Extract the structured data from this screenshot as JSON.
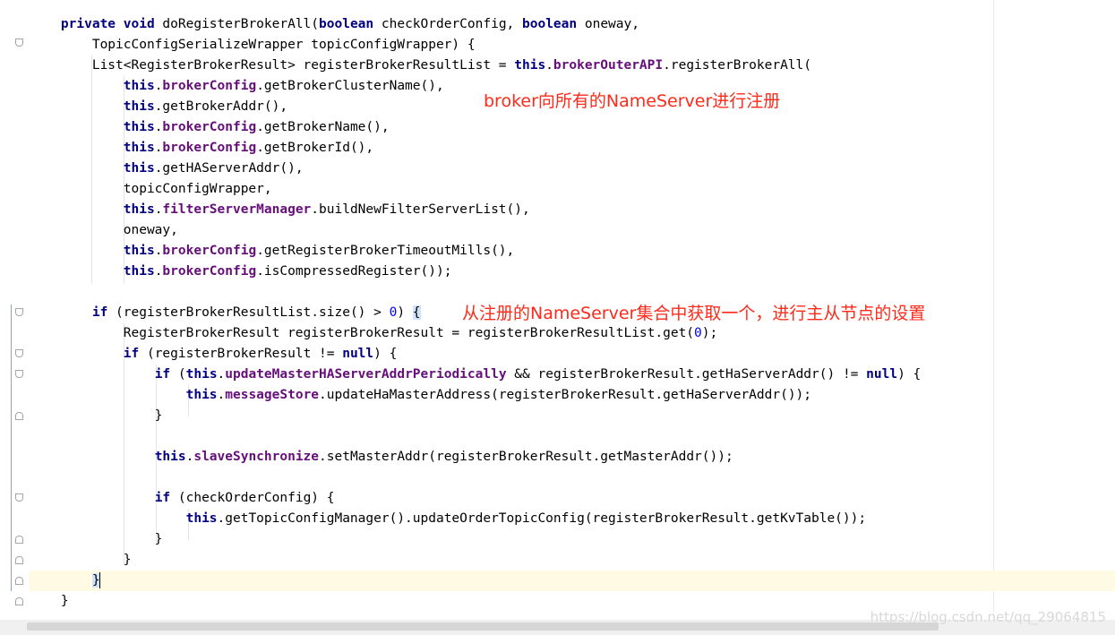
{
  "editor": {
    "lines": [
      [
        {
          "t": "    "
        },
        {
          "t": "private void ",
          "c": "kw"
        },
        {
          "t": "doRegisterBrokerAll("
        },
        {
          "t": "boolean ",
          "c": "kw"
        },
        {
          "t": "checkOrderConfig, "
        },
        {
          "t": "boolean ",
          "c": "kw"
        },
        {
          "t": "oneway,"
        }
      ],
      [
        {
          "t": "        TopicConfigSerializeWrapper topicConfigWrapper) {"
        }
      ],
      [
        {
          "t": "        List<RegisterBrokerResult> registerBrokerResultList = "
        },
        {
          "t": "this",
          "c": "kw"
        },
        {
          "t": "."
        },
        {
          "t": "brokerOuterAPI",
          "c": "field"
        },
        {
          "t": ".registerBrokerAll("
        }
      ],
      [
        {
          "t": "            "
        },
        {
          "t": "this",
          "c": "kw"
        },
        {
          "t": "."
        },
        {
          "t": "brokerConfig",
          "c": "field"
        },
        {
          "t": ".getBrokerClusterName(),"
        }
      ],
      [
        {
          "t": "            "
        },
        {
          "t": "this",
          "c": "kw"
        },
        {
          "t": ".getBrokerAddr(),"
        }
      ],
      [
        {
          "t": "            "
        },
        {
          "t": "this",
          "c": "kw"
        },
        {
          "t": "."
        },
        {
          "t": "brokerConfig",
          "c": "field"
        },
        {
          "t": ".getBrokerName(),"
        }
      ],
      [
        {
          "t": "            "
        },
        {
          "t": "this",
          "c": "kw"
        },
        {
          "t": "."
        },
        {
          "t": "brokerConfig",
          "c": "field"
        },
        {
          "t": ".getBrokerId(),"
        }
      ],
      [
        {
          "t": "            "
        },
        {
          "t": "this",
          "c": "kw"
        },
        {
          "t": ".getHAServerAddr(),"
        }
      ],
      [
        {
          "t": "            topicConfigWrapper,"
        }
      ],
      [
        {
          "t": "            "
        },
        {
          "t": "this",
          "c": "kw"
        },
        {
          "t": "."
        },
        {
          "t": "filterServerManager",
          "c": "field"
        },
        {
          "t": ".buildNewFilterServerList(),"
        }
      ],
      [
        {
          "t": "            oneway,"
        }
      ],
      [
        {
          "t": "            "
        },
        {
          "t": "this",
          "c": "kw"
        },
        {
          "t": "."
        },
        {
          "t": "brokerConfig",
          "c": "field"
        },
        {
          "t": ".getRegisterBrokerTimeoutMills(),"
        }
      ],
      [
        {
          "t": "            "
        },
        {
          "t": "this",
          "c": "kw"
        },
        {
          "t": "."
        },
        {
          "t": "brokerConfig",
          "c": "field"
        },
        {
          "t": ".isCompressedRegister());"
        }
      ],
      [
        {
          "t": ""
        }
      ],
      [
        {
          "t": "        "
        },
        {
          "t": "if ",
          "c": "kw"
        },
        {
          "t": "(registerBrokerResultList.size() > "
        },
        {
          "t": "0",
          "c": "num"
        },
        {
          "t": ") "
        },
        {
          "t": "{",
          "c": "brace-hl"
        }
      ],
      [
        {
          "t": "            RegisterBrokerResult registerBrokerResult = registerBrokerResultList.get("
        },
        {
          "t": "0",
          "c": "num"
        },
        {
          "t": ");"
        }
      ],
      [
        {
          "t": "            "
        },
        {
          "t": "if ",
          "c": "kw"
        },
        {
          "t": "(registerBrokerResult != "
        },
        {
          "t": "null",
          "c": "kw"
        },
        {
          "t": ") {"
        }
      ],
      [
        {
          "t": "                "
        },
        {
          "t": "if ",
          "c": "kw"
        },
        {
          "t": "("
        },
        {
          "t": "this",
          "c": "kw"
        },
        {
          "t": "."
        },
        {
          "t": "updateMasterHAServerAddrPeriodically",
          "c": "field"
        },
        {
          "t": " && registerBrokerResult.getHaServerAddr() != "
        },
        {
          "t": "null",
          "c": "kw"
        },
        {
          "t": ") {"
        }
      ],
      [
        {
          "t": "                    "
        },
        {
          "t": "this",
          "c": "kw"
        },
        {
          "t": "."
        },
        {
          "t": "messageStore",
          "c": "field"
        },
        {
          "t": ".updateHaMasterAddress(registerBrokerResult.getHaServerAddr());"
        }
      ],
      [
        {
          "t": "                }"
        }
      ],
      [
        {
          "t": ""
        }
      ],
      [
        {
          "t": "                "
        },
        {
          "t": "this",
          "c": "kw"
        },
        {
          "t": "."
        },
        {
          "t": "slaveSynchronize",
          "c": "field"
        },
        {
          "t": ".setMasterAddr(registerBrokerResult.getMasterAddr());"
        }
      ],
      [
        {
          "t": ""
        }
      ],
      [
        {
          "t": "                "
        },
        {
          "t": "if ",
          "c": "kw"
        },
        {
          "t": "(checkOrderConfig) {"
        }
      ],
      [
        {
          "t": "                    "
        },
        {
          "t": "this",
          "c": "kw"
        },
        {
          "t": ".getTopicConfigManager().updateOrderTopicConfig(registerBrokerResult.getKvTable());"
        }
      ],
      [
        {
          "t": "                }"
        }
      ],
      [
        {
          "t": "            }"
        }
      ],
      [
        {
          "t": "        "
        },
        {
          "t": "}",
          "c": "brace-hl"
        }
      ],
      [
        {
          "t": "    }"
        }
      ]
    ]
  },
  "annotations": {
    "note1": "broker向所有的NameServer进行注册",
    "note2": "从注册的NameServer集合中获取一个，进行主从节点的设置"
  },
  "watermark": "https://blog.csdn.net/qq_29064815",
  "colors": {
    "keyword": "#000080",
    "field": "#660e7a",
    "number": "#0000ff",
    "annotation": "#ff2a1a",
    "current_line": "#fffae3"
  }
}
